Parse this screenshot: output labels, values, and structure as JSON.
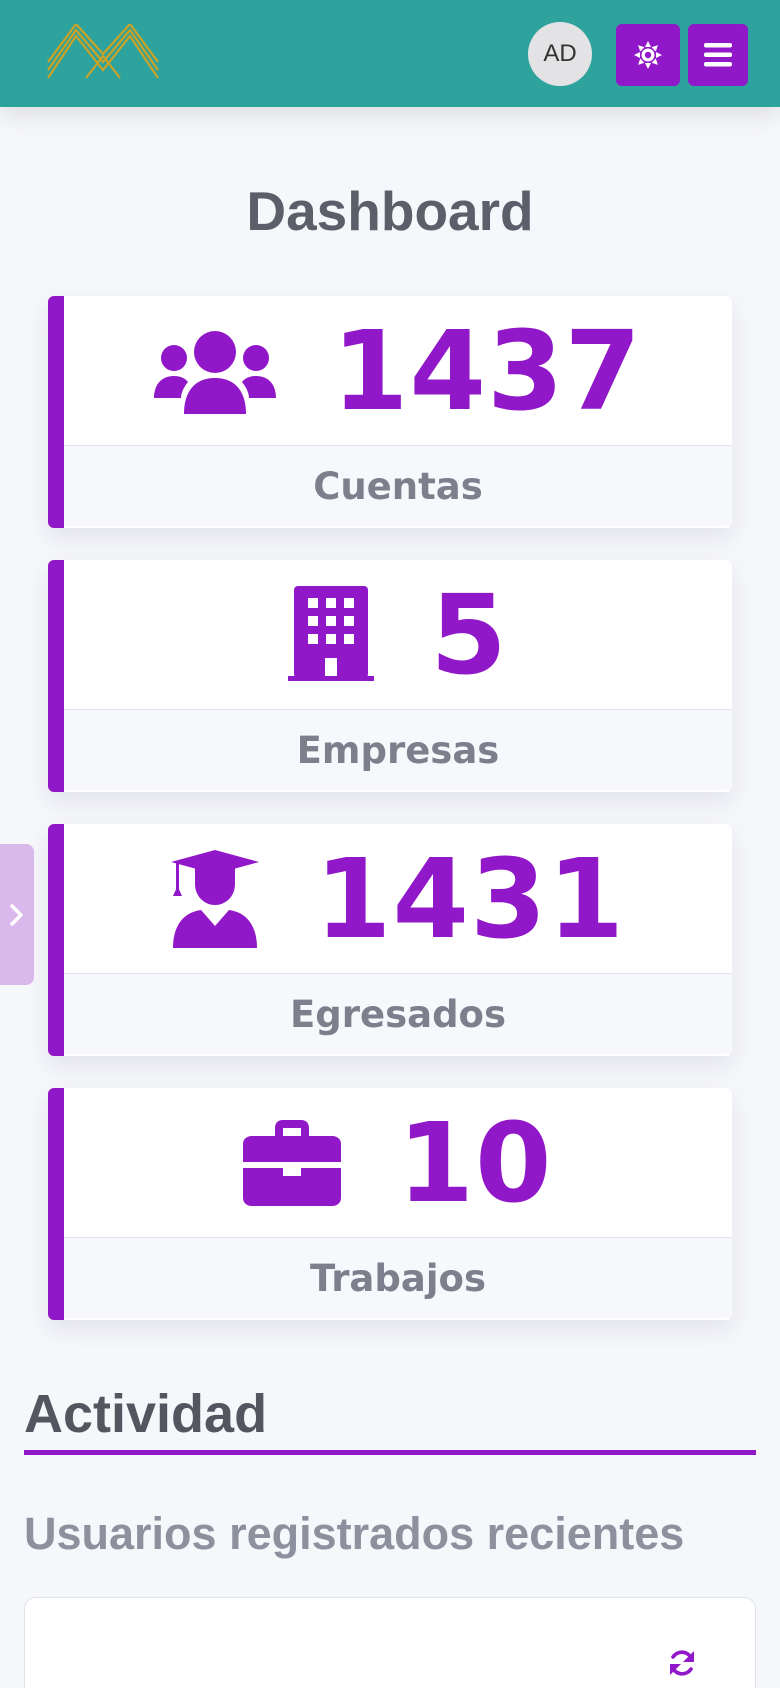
{
  "header": {
    "avatar_initials": "AD",
    "theme_icon": "sun-icon",
    "menu_icon": "hamburger-menu-icon",
    "brand_color": "#2ea29c",
    "accent_color": "#9118c9",
    "logo_color": "#c9a227"
  },
  "page": {
    "title": "Dashboard"
  },
  "stats": [
    {
      "value": "1437",
      "label": "Cuentas",
      "icon": "users-icon"
    },
    {
      "value": "5",
      "label": "Empresas",
      "icon": "building-icon"
    },
    {
      "value": "1431",
      "label": "Egresados",
      "icon": "graduate-icon"
    },
    {
      "value": "10",
      "label": "Trabajos",
      "icon": "briefcase-icon"
    }
  ],
  "sidebar_toggle": {
    "icon": "chevron-right-icon"
  },
  "activity": {
    "title": "Actividad",
    "recent_users_title": "Usuarios registrados recientes",
    "refresh_icon": "refresh-icon"
  }
}
